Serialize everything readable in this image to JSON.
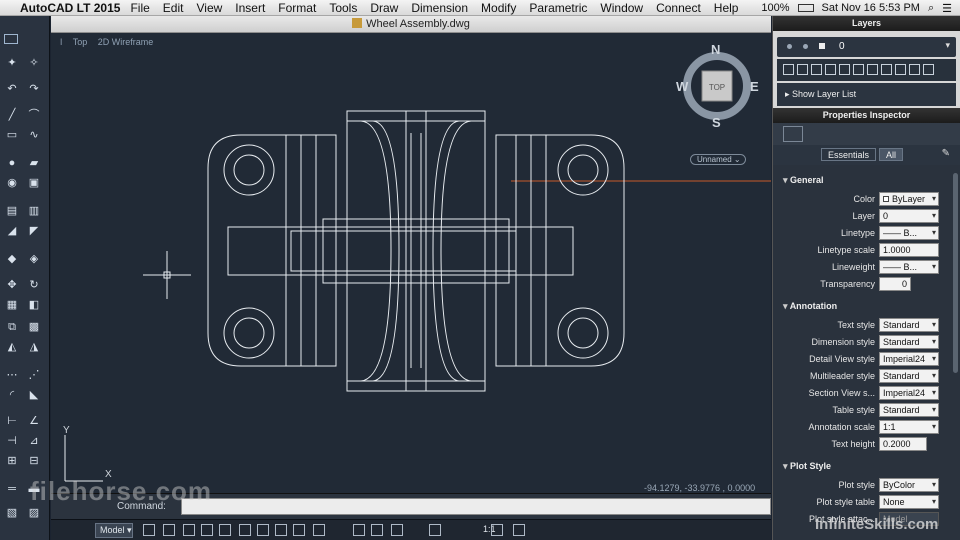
{
  "menu": {
    "app_name": "AutoCAD LT 2015",
    "items": [
      "File",
      "Edit",
      "View",
      "Insert",
      "Format",
      "Tools",
      "Draw",
      "Dimension",
      "Modify",
      "Parametric",
      "Window",
      "Connect",
      "Help"
    ],
    "battery": "100%",
    "clock": "Sat Nov 16  5:53 PM"
  },
  "document": {
    "title": "Wheel Assembly.dwg"
  },
  "viewport": {
    "view_name": "Top",
    "visual_style": "2D Wireframe",
    "viewcube_face": "TOP",
    "compass": {
      "n": "N",
      "s": "S",
      "e": "E",
      "w": "W"
    },
    "ucs_menu": "Unnamed",
    "axis_y": "Y",
    "axis_x": "X"
  },
  "coords": "-94.1279, -33.9776 , 0.0000",
  "command": {
    "label": "Command:",
    "value": ""
  },
  "statusbar": {
    "model_tab": "Model",
    "annotation_scale": "1:1"
  },
  "layers_panel": {
    "title": "Layers",
    "current_layer": "0",
    "show_layer_list": "Show Layer List"
  },
  "properties": {
    "title": "Properties Inspector",
    "toggle": {
      "essentials": "Essentials",
      "all": "All"
    },
    "general": {
      "header": "General",
      "rows": [
        {
          "label": "Color",
          "value": "ByLayer"
        },
        {
          "label": "Layer",
          "value": "0"
        },
        {
          "label": "Linetype",
          "value": "B..."
        },
        {
          "label": "Linetype scale",
          "value": "1.0000"
        },
        {
          "label": "Lineweight",
          "value": "B..."
        },
        {
          "label": "Transparency",
          "value": "0"
        }
      ]
    },
    "annotation": {
      "header": "Annotation",
      "rows": [
        {
          "label": "Text style",
          "value": "Standard"
        },
        {
          "label": "Dimension style",
          "value": "Standard"
        },
        {
          "label": "Detail View style",
          "value": "Imperial24"
        },
        {
          "label": "Multileader style",
          "value": "Standard"
        },
        {
          "label": "Section View s...",
          "value": "Imperial24"
        },
        {
          "label": "Table style",
          "value": "Standard"
        },
        {
          "label": "Annotation scale",
          "value": "1:1"
        },
        {
          "label": "Text height",
          "value": "0.2000"
        }
      ]
    },
    "plot": {
      "header": "Plot Style",
      "rows": [
        {
          "label": "Plot style",
          "value": "ByColor"
        },
        {
          "label": "Plot style table",
          "value": "None"
        },
        {
          "label": "Plot style attac...",
          "value": "Model"
        }
      ]
    }
  },
  "watermarks": {
    "left": "filehorse.com",
    "right": "InfiniteSkills.com"
  },
  "colors": {
    "canvas": "#212a36",
    "panel": "#2a323d",
    "accent_line": "#c85a2a"
  }
}
